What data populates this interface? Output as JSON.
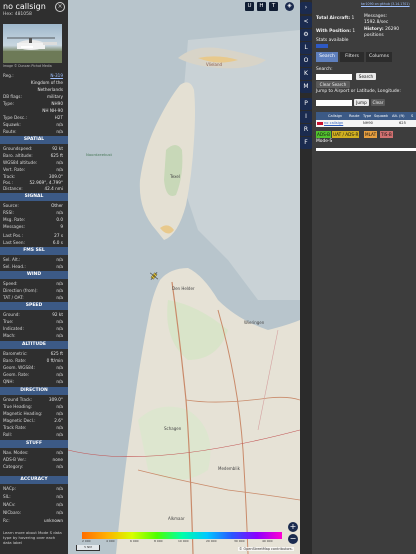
{
  "info": {
    "callsign": "no callsign",
    "hex_label": "Hex:",
    "hex_value": "481058",
    "photo_credit": "Image © Duncan Pichot Media",
    "reg_rows": [
      {
        "k": "Reg.:",
        "v": "N-319"
      },
      {
        "k": "",
        "v": "Kingdom of the"
      },
      {
        "k": "",
        "v": "Netherlands"
      },
      {
        "k": "DB flags:",
        "v": "military"
      },
      {
        "k": "Type:",
        "v": "NH90"
      },
      {
        "k": "",
        "v": "NH NH-90"
      },
      {
        "k": "Type Desc.:",
        "v": "H2T"
      },
      {
        "k": "Squawk:",
        "v": "n/a"
      },
      {
        "k": "Route:",
        "v": "n/a"
      }
    ],
    "sections": {
      "spatial": "SPATIAL",
      "signal": "SIGNAL",
      "fms_sel": "FMS SEL",
      "wind": "WIND",
      "speed": "SPEED",
      "altitude": "ALTITUDE",
      "direction": "DIRECTION",
      "stuff": "STUFF",
      "accuracy": "ACCURACY"
    },
    "spatial": [
      {
        "k": "Groundspeed:",
        "v": "92 kt"
      },
      {
        "k": "Baro. altitude:",
        "v": "625 ft"
      },
      {
        "k": "WGS84 altitude:",
        "v": "n/a"
      },
      {
        "k": "Vert. Rate:",
        "v": "n/a"
      },
      {
        "k": "Track:",
        "v": "309.0°"
      },
      {
        "k": "Pos.:",
        "v": "52.969°, 4.799°"
      },
      {
        "k": "Distance:",
        "v": "42.4 nmi"
      }
    ],
    "signal": [
      {
        "k": "Source:",
        "v": "Other"
      },
      {
        "k": "RSSI:",
        "v": "n/a"
      },
      {
        "k": "Msg. Rate:",
        "v": "0.0"
      },
      {
        "k": "Messages:",
        "v": "9"
      },
      {
        "k": "Last Pos.:",
        "v": "27 s"
      },
      {
        "k": "Last Seen:",
        "v": "6.0 s"
      }
    ],
    "fms": [
      {
        "k": "Sel. Alt.:",
        "v": "n/a"
      },
      {
        "k": "Sel. Head.:",
        "v": "n/a"
      }
    ],
    "wind": [
      {
        "k": "Speed:",
        "v": "n/a"
      },
      {
        "k": "Direction (from):",
        "v": "n/a"
      },
      {
        "k": "TAT / OAT:",
        "v": "n/a"
      }
    ],
    "speed": [
      {
        "k": "Ground:",
        "v": "92 kt"
      },
      {
        "k": "True:",
        "v": "n/a"
      },
      {
        "k": "Indicated:",
        "v": "n/a"
      },
      {
        "k": "Mach:",
        "v": "n/a"
      }
    ],
    "altitude": [
      {
        "k": "Barometric:",
        "v": "625 ft"
      },
      {
        "k": "Baro. Rate:",
        "v": "0 ft/min"
      },
      {
        "k": "Geom. WGS84:",
        "v": "n/a"
      },
      {
        "k": "Geom. Rate:",
        "v": "n/a"
      },
      {
        "k": "QNH:",
        "v": "n/a"
      }
    ],
    "direction": [
      {
        "k": "Ground Track:",
        "v": "309.0°"
      },
      {
        "k": "True Heading:",
        "v": "n/a"
      },
      {
        "k": "Magnetic Heading:",
        "v": "n/a"
      },
      {
        "k": "Magnetic Decl.:",
        "v": "2.6°"
      },
      {
        "k": "Track Rate:",
        "v": "n/a"
      },
      {
        "k": "Roll:",
        "v": "n/a"
      }
    ],
    "stuff": [
      {
        "k": "Nav. Modes:",
        "v": "n/a"
      },
      {
        "k": "ADS-B Ver.:",
        "v": "none"
      },
      {
        "k": "Category:",
        "v": "n/a"
      }
    ],
    "accuracy": [
      {
        "k": "NACp:",
        "v": "n/a"
      },
      {
        "k": "SIL:",
        "v": "n/a"
      },
      {
        "k": "NACv:",
        "v": "n/a"
      },
      {
        "k": "NICbaro:",
        "v": "n/a"
      },
      {
        "k": "Rc:",
        "v": "unknown"
      }
    ],
    "footer_note": "Learn more about Mode S data type by hovering over each data label"
  },
  "map": {
    "top_buttons": [
      "U",
      "H",
      "T"
    ],
    "side_buttons": [
      "<",
      "L",
      "O",
      "K",
      "M",
      "P",
      "I",
      "R",
      "F"
    ],
    "labels": {
      "vlieland": "Vlieland",
      "texel": "Texel",
      "noordzee": "Noordzeekust",
      "den_helder": "Den Helder",
      "wieringen": "Wieringen",
      "medemblik": "Medemblik",
      "schagen": "Schagen",
      "alkmaar": "Alkmaar"
    },
    "colorbar_ticks": [
      "2 000",
      "4 000",
      "6 000",
      "8 000",
      "10 000",
      "20 000",
      "30 000",
      "40 000"
    ],
    "scale": "5 NM",
    "attribution": "© OpenStreetMap contributors."
  },
  "right": {
    "version_link": "tar1090 on github (3.14.1701)",
    "total_label": "Total Aircraft:",
    "total_value": "1",
    "position_label": "With Position:",
    "position_value": "1",
    "messages_label": "Messages:",
    "messages_value": "1592.8/sec",
    "history_label": "History:",
    "history_value": "26290",
    "history_unit": "positions",
    "stats_label": "Stats available",
    "tabs": [
      "Search",
      "Filters",
      "Columns"
    ],
    "search_label": "Search:",
    "search_button": "Search",
    "clear_button": "Clear Search",
    "jump_label": "Jump to Airport or Latitude, Longitude:",
    "jump_button": "Jump",
    "jump_clear": "Clear",
    "columns": [
      "Callsign",
      "Route",
      "Type",
      "Squawk",
      "Alt. (ft)",
      "S"
    ],
    "row": {
      "callsign": "no callsign",
      "route": "",
      "type": "NH90",
      "squawk": "",
      "alt": "625"
    },
    "legend": [
      "ADS-B",
      "UAT / ADS-R",
      "MLAT",
      "TIS-B"
    ],
    "modes": "Mode-S",
    "colors": {
      "adsb": "#52c22e",
      "uat": "#d0b020",
      "mlat": "#e8a040",
      "tisb": "#d07070"
    }
  }
}
